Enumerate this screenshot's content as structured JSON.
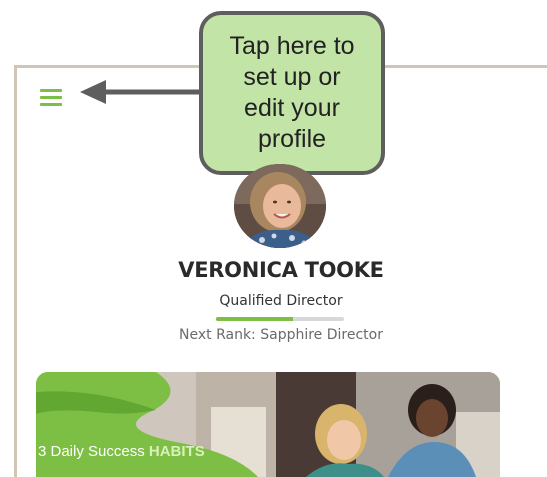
{
  "tooltip": {
    "text": "Tap here to\nset up or\nedit your\nprofile"
  },
  "header": {
    "menu_icon": "hamburger-menu-icon"
  },
  "profile": {
    "name": "VERONICA TOOKE",
    "rank": "Qualified Director",
    "rank_progress": 0.6,
    "next_rank": "Next Rank: Sapphire Director"
  },
  "banner": {
    "text_prefix": "3 Daily Success ",
    "text_highlight": "HABITS"
  },
  "colors": {
    "accent_green": "#7cbf44",
    "callout_fill": "#c3e4a7",
    "callout_border": "#5e5e5e",
    "frame_border": "#cfc6b6"
  }
}
